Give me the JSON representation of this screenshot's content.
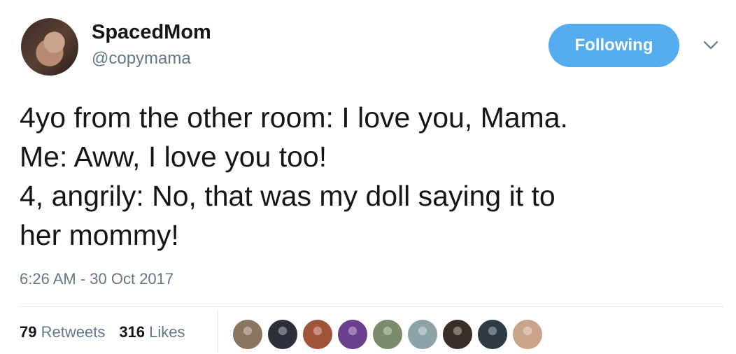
{
  "user": {
    "name": "SpacedMom",
    "handle": "@copymama"
  },
  "follow_button": {
    "label": "Following"
  },
  "tweet": {
    "lines": [
      "4yo from the other room: I love you, Mama.",
      "Me: Aww, I love you too!",
      "4, angrily: No, that was my doll saying it to",
      "her mommy!"
    ]
  },
  "timestamp": "6:26 AM - 30 Oct 2017",
  "stats": {
    "retweets_count": "79",
    "retweets_label": "Retweets",
    "likes_count": "316",
    "likes_label": "Likes"
  },
  "colors": {
    "accent": "#55acee",
    "muted": "#657786",
    "text": "#14171a"
  },
  "likers": [
    {
      "color": "#8a7560"
    },
    {
      "color": "#2c2f3a"
    },
    {
      "color": "#a0553a"
    },
    {
      "color": "#6a3f8f"
    },
    {
      "color": "#7b8a6a"
    },
    {
      "color": "#8ea3a8"
    },
    {
      "color": "#3a2e28"
    },
    {
      "color": "#2b3a44"
    },
    {
      "color": "#c9a48a"
    }
  ]
}
